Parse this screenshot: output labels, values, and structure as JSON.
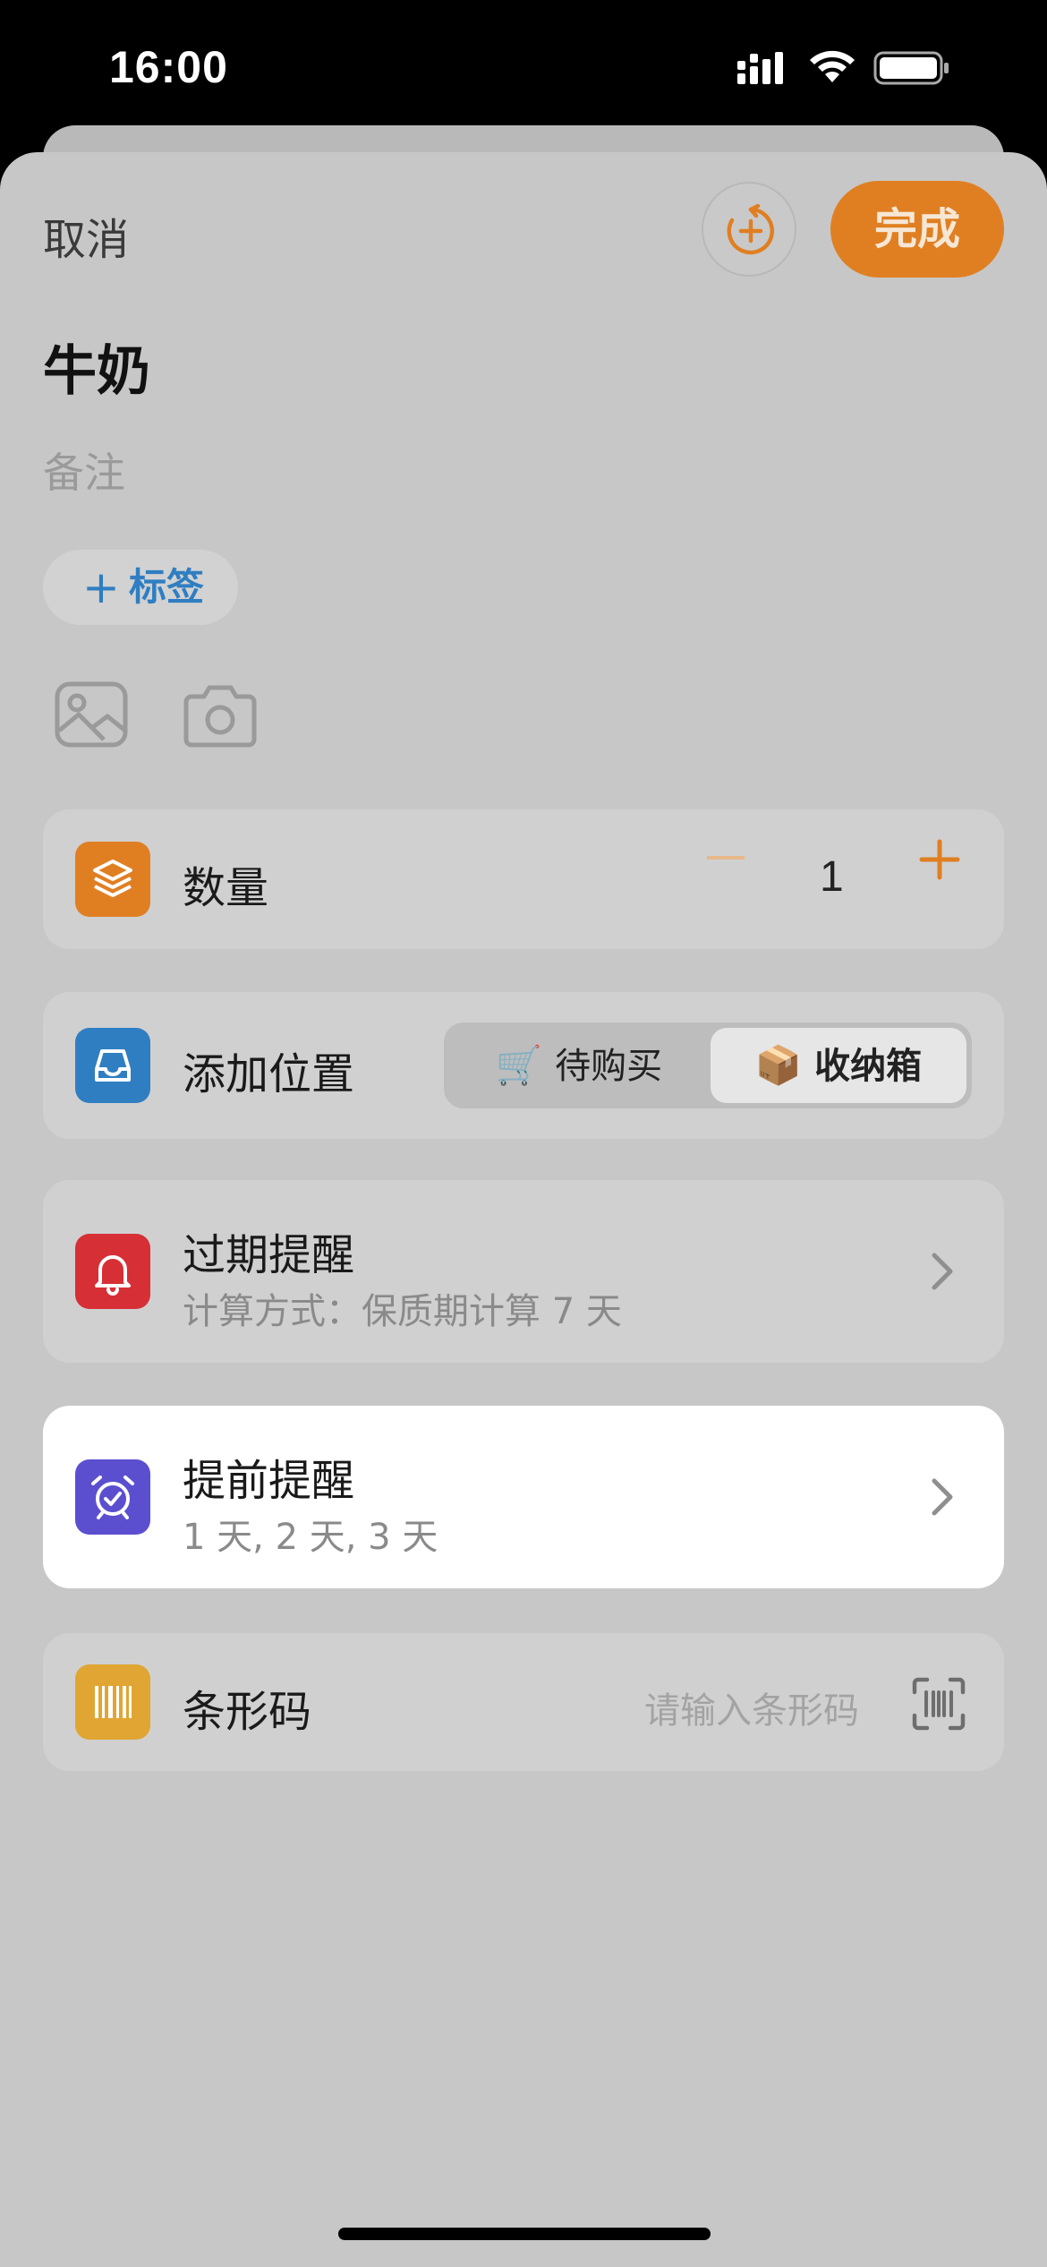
{
  "status_bar": {
    "time": "16:00"
  },
  "header": {
    "cancel_label": "取消",
    "done_label": "完成"
  },
  "item": {
    "name": "牛奶",
    "notes_placeholder": "备注",
    "add_tag_label": "标签"
  },
  "quantity": {
    "label": "数量",
    "value": "1"
  },
  "location": {
    "label": "添加位置",
    "options": [
      {
        "emoji": "🛒",
        "label": "待购买"
      },
      {
        "emoji": "📦",
        "label": "收纳箱"
      }
    ],
    "selected": "收纳箱"
  },
  "expiry": {
    "title": "过期提醒",
    "subtitle": "计算方式：保质期计算 7 天"
  },
  "advance_reminder": {
    "title": "提前提醒",
    "subtitle": "1 天, 2 天, 3 天"
  },
  "barcode": {
    "label": "条形码",
    "placeholder": "请输入条形码"
  },
  "colors": {
    "accent": "#e07f22",
    "quantity_icon": "#e07f22",
    "location_icon": "#2f7ec2",
    "expiry_icon": "#d62f36",
    "reminder_icon": "#5b4fd0",
    "barcode_icon": "#e0a532"
  },
  "icons": {
    "history": "history-add-icon",
    "tag_plus": "plus-icon",
    "photo_library": "image-icon",
    "camera": "camera-icon",
    "quantity": "layers-icon",
    "location": "tray-icon",
    "expiry": "bell-icon",
    "reminder": "alarm-clock-icon",
    "barcode": "barcode-icon",
    "scan": "barcode-scan-icon"
  }
}
